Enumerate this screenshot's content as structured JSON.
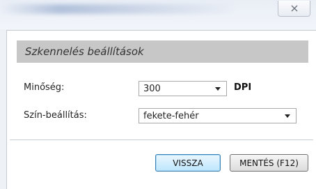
{
  "window": {
    "close_glyph": "☒",
    "close_icon": "close-icon"
  },
  "section": {
    "title": "Szkennelés beállítások"
  },
  "form": {
    "quality": {
      "label": "Minőség:",
      "value": "300",
      "unit": "DPI"
    },
    "color": {
      "label": "Szín-beállítás:",
      "value": "fekete-fehér"
    }
  },
  "buttons": {
    "back": "VISSZA",
    "save": "MENTÉS (F12)"
  },
  "colors": {
    "header_bg": "#c7c7c7",
    "primary_border": "#3c7fb1",
    "primary_fill": "#bee6fd"
  }
}
